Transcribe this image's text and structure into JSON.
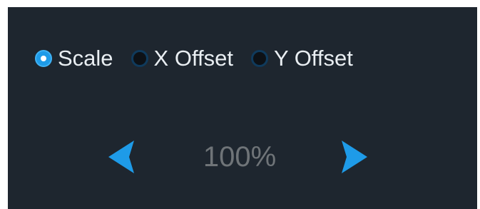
{
  "radio_options": [
    {
      "label": "Scale",
      "selected": true
    },
    {
      "label": "X Offset",
      "selected": false
    },
    {
      "label": "Y Offset",
      "selected": false
    }
  ],
  "stepper": {
    "value": "100%",
    "left_icon": "chevron-left-icon",
    "right_icon": "chevron-right-icon"
  },
  "colors": {
    "panel_background": "#1e262f",
    "accent": "#1e9be8",
    "label_text": "#e9eef2",
    "value_text": "#6f7478"
  }
}
